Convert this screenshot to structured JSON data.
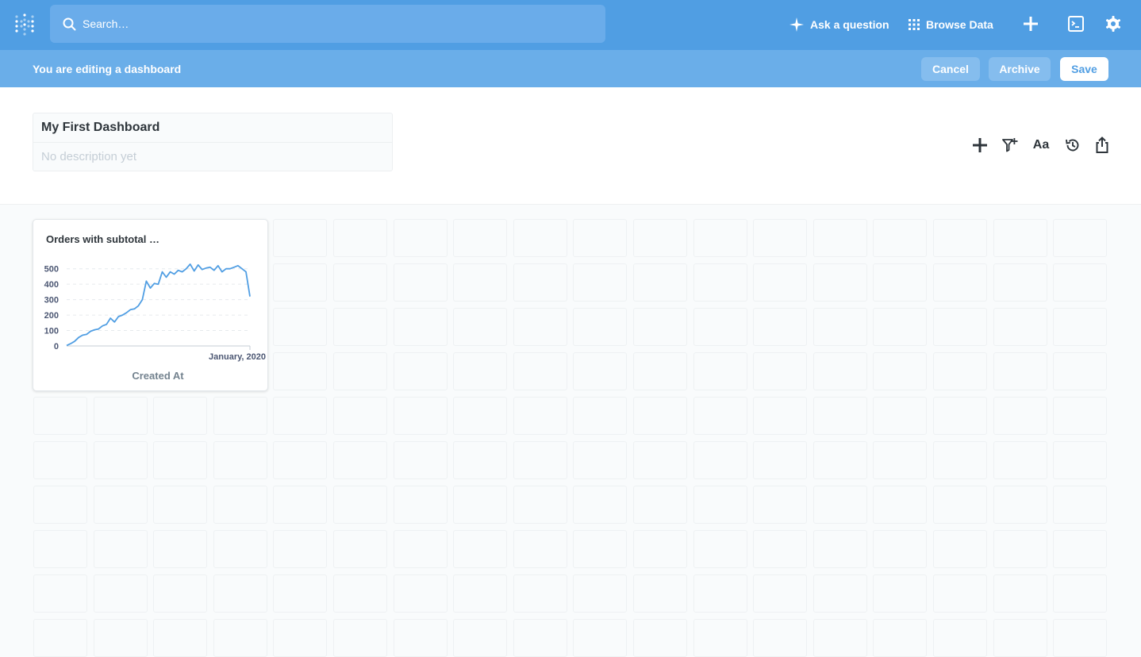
{
  "nav": {
    "search_placeholder": "Search…",
    "ask_label": "Ask a question",
    "browse_label": "Browse Data"
  },
  "editbar": {
    "message": "You are editing a dashboard",
    "cancel": "Cancel",
    "archive": "Archive",
    "save": "Save"
  },
  "dashboard": {
    "title": "My First Dashboard",
    "description_placeholder": "No description yet",
    "tools": {
      "add_icon": "plus-icon",
      "filter_icon": "filter-add-icon",
      "text_label": "Aa",
      "history_icon": "history-icon",
      "share_icon": "share-icon"
    }
  },
  "colors": {
    "brand": "#509ee3",
    "editbar": "#6aaee9",
    "line": "#509ee3"
  },
  "card": {
    "title": "Orders with subtotal …",
    "chart_data": {
      "type": "line",
      "title": "",
      "xlabel": "Created At",
      "ylabel": "",
      "x_tick_label": "January, 2020",
      "y_ticks": [
        0,
        100,
        200,
        300,
        400,
        500
      ],
      "ylim": [
        0,
        550
      ],
      "grid": true,
      "values": [
        3,
        15,
        30,
        55,
        70,
        75,
        95,
        105,
        110,
        130,
        140,
        180,
        155,
        190,
        200,
        215,
        235,
        240,
        260,
        300,
        420,
        375,
        405,
        400,
        480,
        445,
        480,
        465,
        490,
        480,
        500,
        530,
        485,
        525,
        495,
        505,
        510,
        490,
        520,
        480,
        500,
        500,
        510,
        520,
        500,
        480,
        320
      ]
    }
  }
}
